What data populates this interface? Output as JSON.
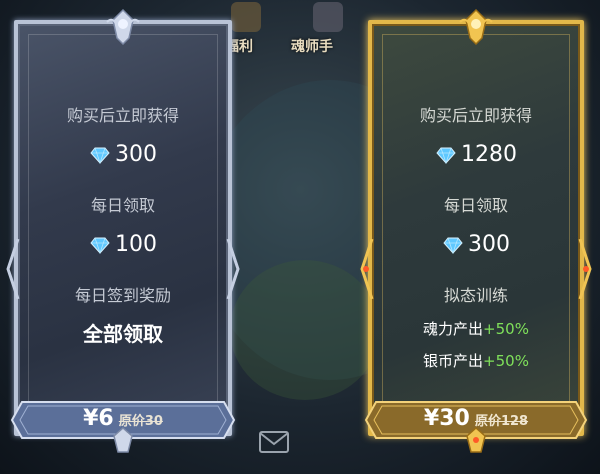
{
  "hud": {
    "label_left": "福利",
    "label_right": "魂师手"
  },
  "card_left": {
    "line1": "购买后立即获得",
    "gem1_amount": "300",
    "line2": "每日领取",
    "gem2_amount": "100",
    "line3": "每日签到奖励",
    "line4": "全部领取",
    "price_current": "¥6",
    "price_original": "原价30"
  },
  "card_right": {
    "line1": "购买后立即获得",
    "gem1_amount": "1280",
    "line2": "每日领取",
    "gem2_amount": "300",
    "line3": "拟态训练",
    "bonus1_label": "魂力产出",
    "bonus1_value": "+50%",
    "bonus2_label": "银币产出",
    "bonus2_value": "+50%",
    "price_current": "¥30",
    "price_original": "原价128"
  },
  "colors": {
    "silver_frame": "#b9c3d6",
    "gold_frame": "#e2b84a",
    "bonus_green": "#7fe05a",
    "gem_blue": "#5fc8ff"
  },
  "icons": [
    "diamond-gem-icon",
    "mail-icon",
    "crest-icon",
    "side-ornament-icon"
  ]
}
